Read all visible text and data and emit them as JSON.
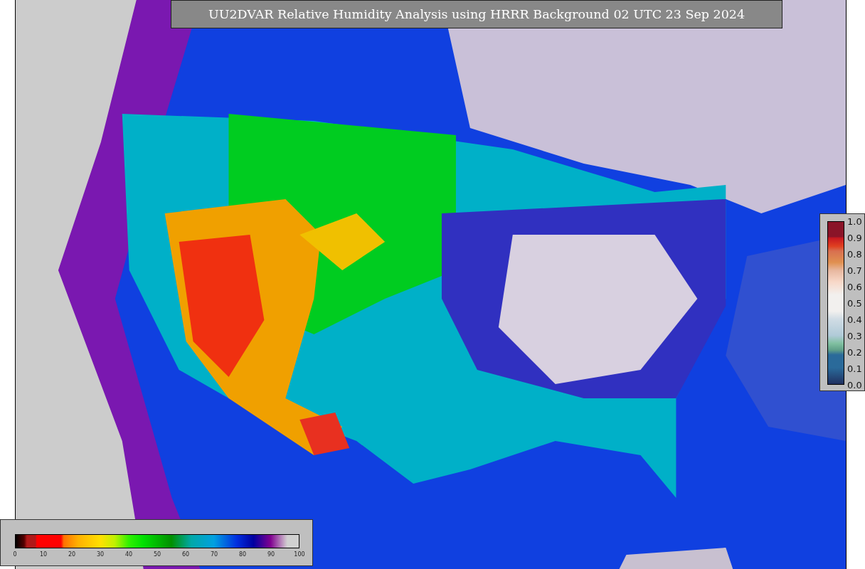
{
  "title": "UU2DVAR Relative Humidity Analysis using HRRR Background 02 UTC 23 Sep 2024",
  "humidity_legend": {
    "ticks": [
      "0",
      "10",
      "20",
      "30",
      "40",
      "50",
      "60",
      "70",
      "80",
      "90",
      "100"
    ]
  },
  "ratio_legend": {
    "ticks": [
      "1.0",
      "0.9",
      "0.8",
      "0.7",
      "0.6",
      "0.5",
      "0.4",
      "0.3",
      "0.2",
      "0.1",
      "0.0"
    ]
  }
}
